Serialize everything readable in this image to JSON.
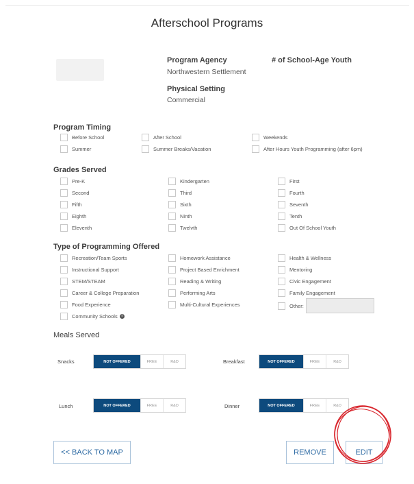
{
  "title": "Afterschool Programs",
  "agency": {
    "label": "Program Agency",
    "value": "Northwestern Settlement"
  },
  "youth": {
    "label": "# of School-Age Youth"
  },
  "setting": {
    "label": "Physical Setting",
    "value": "Commercial"
  },
  "timing": {
    "heading": "Program Timing",
    "items": [
      "Before School",
      "After School",
      "Weekends",
      "Summer",
      "Summer Breaks/Vacation",
      "After Hours Youth Programming (after 6pm)"
    ]
  },
  "grades": {
    "heading": "Grades Served",
    "items": [
      "Pre-K",
      "Kindergarten",
      "First",
      "Second",
      "Third",
      "Fourth",
      "Fifth",
      "Sixth",
      "Seventh",
      "Eighth",
      "Ninth",
      "Tenth",
      "Eleventh",
      "Twelvth",
      "Out Of School Youth"
    ]
  },
  "programming": {
    "heading": "Type of Programming Offered",
    "items": [
      "Recreation/Team Sports",
      "Homework Assistance",
      "Health & Wellness",
      "Instructional Support",
      "Project Based Enrichment",
      "Mentoring",
      "STEM/STEAM",
      "Reading & Writing",
      "Civic Engagement",
      "Career & College Preparation",
      "Performing Arts",
      "Family Engagement",
      "Food Experience",
      "Multi-Cultural Experiences",
      "Other:",
      "Community Schools"
    ]
  },
  "meals": {
    "heading": "Meals Served",
    "options": [
      "NOT OFFERED",
      "FREE",
      "R&D"
    ],
    "items": [
      {
        "label": "Snacks",
        "selected": "NOT OFFERED"
      },
      {
        "label": "Breakfast",
        "selected": "NOT OFFERED"
      },
      {
        "label": "Lunch",
        "selected": "NOT OFFERED"
      },
      {
        "label": "Dinner",
        "selected": "NOT OFFERED"
      }
    ]
  },
  "buttons": {
    "back": "<< BACK TO MAP",
    "remove": "REMOVE",
    "edit": "EDIT"
  },
  "colors": {
    "selected_segment": "#0d4a7d",
    "button_text": "#2d6aa3",
    "highlight_circle": "#d9282f"
  },
  "icons": {
    "info": "info-circle-icon"
  }
}
